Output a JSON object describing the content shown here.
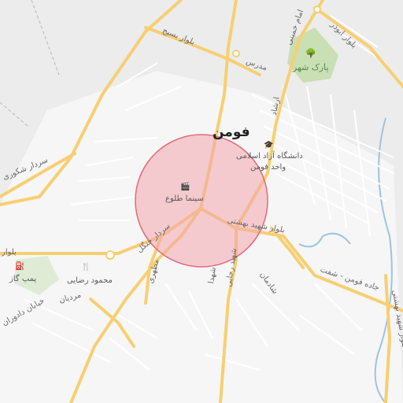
{
  "map": {
    "city_label": "فومن",
    "pois": {
      "university_line1": "دانشگاه آزاد اسلامی",
      "university_line2": "واحد فومن",
      "cinema": "سینما طلوع",
      "park": "پارک شهر",
      "gas_station": "پمپ گاز",
      "restaurant": "محمود رضایی"
    },
    "roads": {
      "basij": "بلوار بسیج",
      "modarres": "مدرس",
      "abouzar": "بلوار ابوذر",
      "khomeini": "امام خمینی",
      "bolvar_left": "بلوار",
      "shahid_beheshti": "بلوار شهید بهشتی",
      "sardar_jangal": "سردار جنگل",
      "motahari": "مطهری",
      "shahid_rajaee": "شهید رجایی",
      "shademan": "شادمان",
      "fouman_shaft": "جاده فومن - شفت",
      "shohada": "شهدا",
      "ershad": "ارشاد",
      "dadvaran": "خیابان دادوران",
      "mardian": "مردیان",
      "shahid_beheshti_vertical": "بلوار شهید بهشتی",
      "fouman_masal": "بلوار فومن",
      "ajami": "امام خمینی",
      "kenar_sardar": "سردار شکوری"
    },
    "colors": {
      "background": "#ececec",
      "block": "#f7f7f7",
      "major_road": "#f7cf72",
      "minor_road": "#ffffff",
      "park": "#c9dfb4",
      "water": "#9ec3e0",
      "highlight_fill": "#f2a6ad",
      "highlight_stroke": "#e46a78"
    },
    "icons": {
      "university": "graduation-cap-icon",
      "cinema": "film-icon",
      "park": "tree-icon",
      "gas": "fuel-icon",
      "restaurant": "fork-knife-icon"
    }
  }
}
